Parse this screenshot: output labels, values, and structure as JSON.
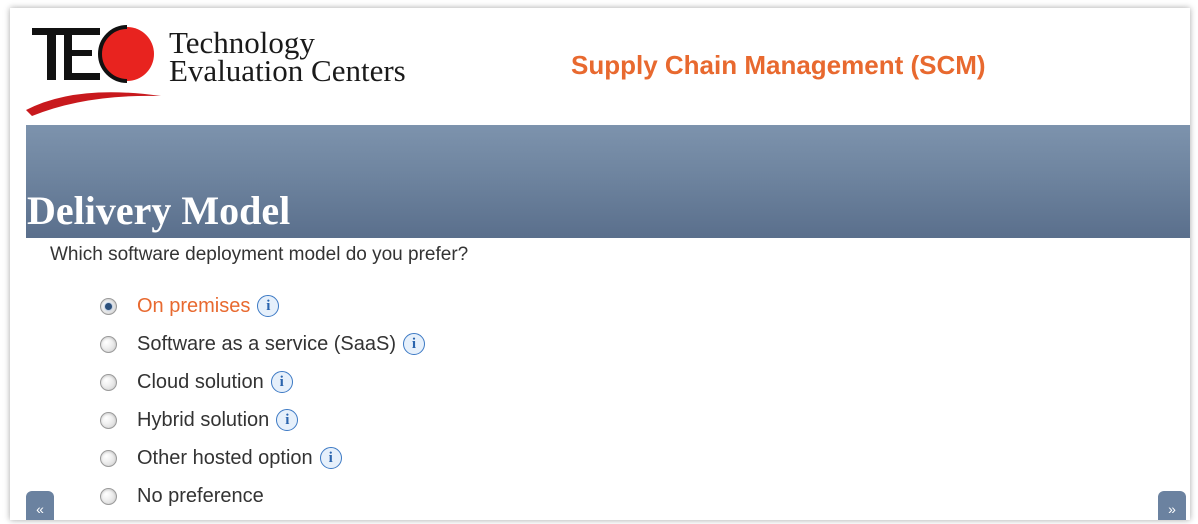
{
  "header": {
    "logo_line1": "Technology",
    "logo_line2": "Evaluation Centers",
    "logo_mark_text": "TEC",
    "module_title": "Supply Chain Management (SCM)"
  },
  "section": {
    "title": "Delivery Model",
    "question": "Which software deployment model do you prefer?"
  },
  "options": [
    {
      "label": "On premises",
      "selected": true,
      "has_info": true
    },
    {
      "label": "Software as a service (SaaS)",
      "selected": false,
      "has_info": true
    },
    {
      "label": "Cloud solution",
      "selected": false,
      "has_info": true
    },
    {
      "label": "Hybrid solution",
      "selected": false,
      "has_info": true
    },
    {
      "label": "Other hosted option",
      "selected": false,
      "has_info": true
    },
    {
      "label": "No preference",
      "selected": false,
      "has_info": false
    }
  ],
  "icons": {
    "info": "i",
    "prev": "«",
    "next": "»"
  },
  "colors": {
    "accent": "#e8692f",
    "banner": "#6e849f",
    "logo_red": "#e8231f"
  }
}
